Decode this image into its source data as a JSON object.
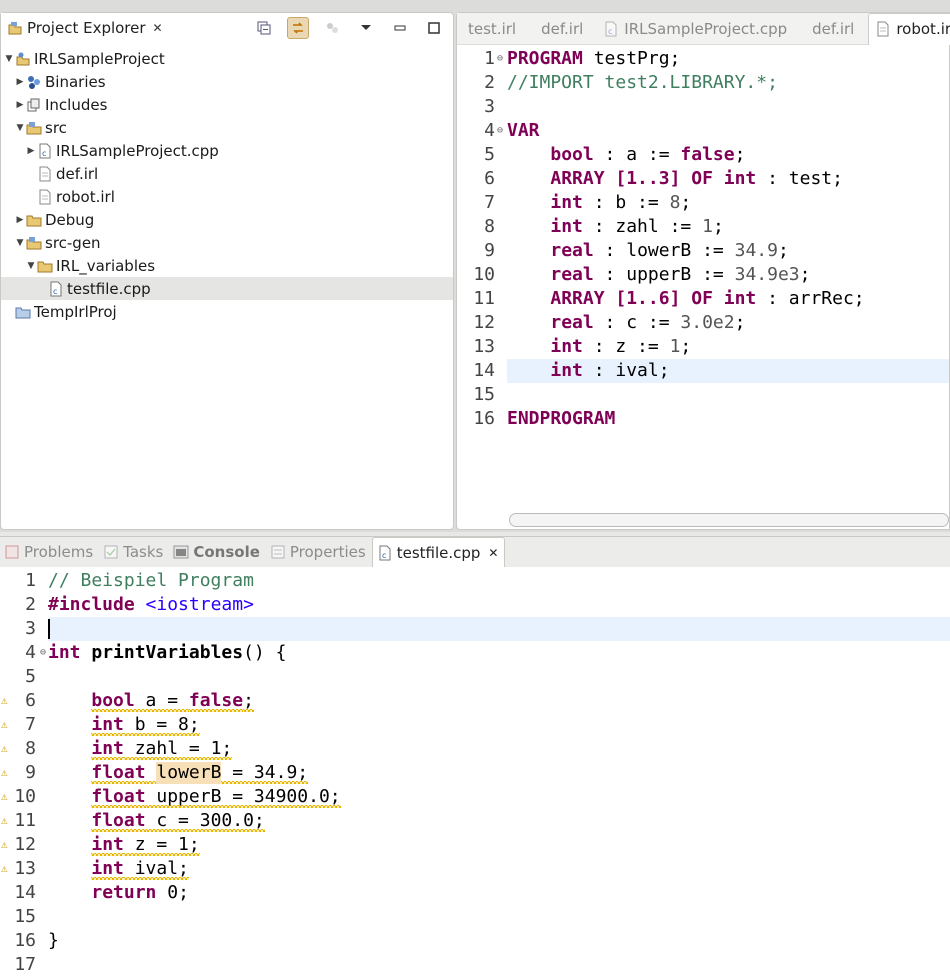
{
  "explorer": {
    "title": "Project Explorer",
    "close_label": "✕",
    "tree": [
      {
        "label": "IRLSampleProject",
        "indent": 0,
        "twisty": "down",
        "icon": "project-icon"
      },
      {
        "label": "Binaries",
        "indent": 1,
        "twisty": "right",
        "icon": "binaries-icon"
      },
      {
        "label": "Includes",
        "indent": 1,
        "twisty": "right",
        "icon": "includes-icon"
      },
      {
        "label": "src",
        "indent": 1,
        "twisty": "down",
        "icon": "source-folder-icon"
      },
      {
        "label": "IRLSampleProject.cpp",
        "indent": 2,
        "twisty": "right",
        "icon": "cpp-file-icon"
      },
      {
        "label": "def.irl",
        "indent": 2,
        "twisty": "",
        "icon": "file-icon"
      },
      {
        "label": "robot.irl",
        "indent": 2,
        "twisty": "",
        "icon": "file-icon"
      },
      {
        "label": "Debug",
        "indent": 1,
        "twisty": "right",
        "icon": "folder-icon"
      },
      {
        "label": "src-gen",
        "indent": 1,
        "twisty": "down",
        "icon": "source-folder-icon"
      },
      {
        "label": "IRL_variables",
        "indent": 2,
        "twisty": "down",
        "icon": "folder-icon"
      },
      {
        "label": "testfile.cpp",
        "indent": 3,
        "twisty": "",
        "icon": "cpp-file-icon",
        "selected": true
      },
      {
        "label": "TempIrlProj",
        "indent": 0,
        "twisty": "",
        "icon": "closed-project-icon"
      }
    ]
  },
  "editor": {
    "tabs": [
      {
        "label": "test.irl",
        "active": false
      },
      {
        "label": "def.irl",
        "active": false
      },
      {
        "label": "IRLSampleProject.cpp",
        "active": false
      },
      {
        "label": "def.irl",
        "active": false
      },
      {
        "label": "robot.irl",
        "active": true
      }
    ],
    "lines": [
      {
        "n": "1",
        "fold": true,
        "tokens": [
          [
            "kw",
            "PROGRAM"
          ],
          [
            "plain",
            " testPrg;"
          ]
        ]
      },
      {
        "n": "2",
        "tokens": [
          [
            "cm",
            "//IMPORT test2.LIBRARY.*;"
          ]
        ]
      },
      {
        "n": "3",
        "tokens": []
      },
      {
        "n": "4",
        "fold": true,
        "tokens": [
          [
            "kw",
            "VAR"
          ]
        ]
      },
      {
        "n": "5",
        "tokens": [
          [
            "plain",
            "    "
          ],
          [
            "kw",
            "bool"
          ],
          [
            "plain",
            " : a := "
          ],
          [
            "kw",
            "false"
          ],
          [
            "plain",
            ";"
          ]
        ]
      },
      {
        "n": "6",
        "tokens": [
          [
            "plain",
            "    "
          ],
          [
            "kw",
            "ARRAY [1..3] OF int"
          ],
          [
            "plain",
            " : test;"
          ]
        ]
      },
      {
        "n": "7",
        "tokens": [
          [
            "plain",
            "    "
          ],
          [
            "kw",
            "int"
          ],
          [
            "plain",
            " : b := "
          ],
          [
            "num",
            "8"
          ],
          [
            "plain",
            ";"
          ]
        ]
      },
      {
        "n": "8",
        "tokens": [
          [
            "plain",
            "    "
          ],
          [
            "kw",
            "int"
          ],
          [
            "plain",
            " : zahl := "
          ],
          [
            "num",
            "1"
          ],
          [
            "plain",
            ";"
          ]
        ]
      },
      {
        "n": "9",
        "tokens": [
          [
            "plain",
            "    "
          ],
          [
            "kw",
            "real"
          ],
          [
            "plain",
            " : lowerB := "
          ],
          [
            "num",
            "34.9"
          ],
          [
            "plain",
            ";"
          ]
        ]
      },
      {
        "n": "10",
        "tokens": [
          [
            "plain",
            "    "
          ],
          [
            "kw",
            "real"
          ],
          [
            "plain",
            " : upperB := "
          ],
          [
            "num",
            "34.9e3"
          ],
          [
            "plain",
            ";"
          ]
        ]
      },
      {
        "n": "11",
        "tokens": [
          [
            "plain",
            "    "
          ],
          [
            "kw",
            "ARRAY [1..6] OF int"
          ],
          [
            "plain",
            " : arrRec;"
          ]
        ]
      },
      {
        "n": "12",
        "tokens": [
          [
            "plain",
            "    "
          ],
          [
            "kw",
            "real"
          ],
          [
            "plain",
            " : c := "
          ],
          [
            "num",
            "3.0e2"
          ],
          [
            "plain",
            ";"
          ]
        ]
      },
      {
        "n": "13",
        "tokens": [
          [
            "plain",
            "    "
          ],
          [
            "kw",
            "int"
          ],
          [
            "plain",
            " : z := "
          ],
          [
            "num",
            "1"
          ],
          [
            "plain",
            ";"
          ]
        ]
      },
      {
        "n": "14",
        "current": true,
        "tokens": [
          [
            "plain",
            "    "
          ],
          [
            "kw",
            "int"
          ],
          [
            "plain",
            " : ival;"
          ]
        ]
      },
      {
        "n": "15",
        "tokens": []
      },
      {
        "n": "16",
        "tokens": [
          [
            "kw",
            "ENDPROGRAM"
          ]
        ]
      }
    ]
  },
  "bottom": {
    "tabs": [
      {
        "label": "Problems",
        "icon": "problems-icon"
      },
      {
        "label": "Tasks",
        "icon": "tasks-icon"
      },
      {
        "label": "Console",
        "icon": "console-icon",
        "bold": true
      },
      {
        "label": "Properties",
        "icon": "properties-icon"
      },
      {
        "label": "testfile.cpp",
        "icon": "cpp-file-icon",
        "active": true,
        "close": "✕"
      }
    ],
    "lines": [
      {
        "n": "1",
        "tokens": [
          [
            "cm",
            "// Beispiel Program"
          ]
        ]
      },
      {
        "n": "2",
        "tokens": [
          [
            "kw",
            "#include"
          ],
          [
            "plain",
            " "
          ],
          [
            "st",
            "<iostream>"
          ]
        ]
      },
      {
        "n": "3",
        "current": true,
        "caret": true,
        "tokens": []
      },
      {
        "n": "4",
        "fold": true,
        "tokens": [
          [
            "kw",
            "int"
          ],
          [
            "plain",
            " "
          ],
          [
            "bold",
            "printVariables"
          ],
          [
            "plain",
            "() {"
          ]
        ]
      },
      {
        "n": "5",
        "tokens": []
      },
      {
        "n": "6",
        "warn": true,
        "tokens": [
          [
            "plain",
            "    "
          ],
          [
            "kwsq",
            "bool"
          ],
          [
            "sq",
            " a = "
          ],
          [
            "kwsq",
            "false"
          ],
          [
            "sq",
            ";"
          ]
        ]
      },
      {
        "n": "7",
        "warn": true,
        "tokens": [
          [
            "plain",
            "    "
          ],
          [
            "kwsq",
            "int"
          ],
          [
            "sq",
            " b = 8;"
          ]
        ]
      },
      {
        "n": "8",
        "warn": true,
        "tokens": [
          [
            "plain",
            "    "
          ],
          [
            "kwsq",
            "int"
          ],
          [
            "sq",
            " zahl = 1;"
          ]
        ]
      },
      {
        "n": "9",
        "warn": true,
        "tokens": [
          [
            "plain",
            "    "
          ],
          [
            "kwsq",
            "float"
          ],
          [
            "sq",
            " "
          ],
          [
            "hl",
            "lowerB"
          ],
          [
            "sq",
            " = 34.9;"
          ]
        ]
      },
      {
        "n": "10",
        "warn": true,
        "tokens": [
          [
            "plain",
            "    "
          ],
          [
            "kwsq",
            "float"
          ],
          [
            "sq",
            " upperB = 34900.0;"
          ]
        ]
      },
      {
        "n": "11",
        "warn": true,
        "tokens": [
          [
            "plain",
            "    "
          ],
          [
            "kwsq",
            "float"
          ],
          [
            "sq",
            " c = 300.0;"
          ]
        ]
      },
      {
        "n": "12",
        "warn": true,
        "tokens": [
          [
            "plain",
            "    "
          ],
          [
            "kwsq",
            "int"
          ],
          [
            "sq",
            " z = 1;"
          ]
        ]
      },
      {
        "n": "13",
        "warn": true,
        "tokens": [
          [
            "plain",
            "    "
          ],
          [
            "kwsq",
            "int"
          ],
          [
            "sq",
            " ival;"
          ]
        ]
      },
      {
        "n": "14",
        "tokens": [
          [
            "plain",
            "    "
          ],
          [
            "kw",
            "return"
          ],
          [
            "plain",
            " 0;"
          ]
        ]
      },
      {
        "n": "15",
        "tokens": []
      },
      {
        "n": "16",
        "tokens": [
          [
            "plain",
            "}"
          ]
        ]
      },
      {
        "n": "17",
        "tokens": []
      }
    ]
  }
}
